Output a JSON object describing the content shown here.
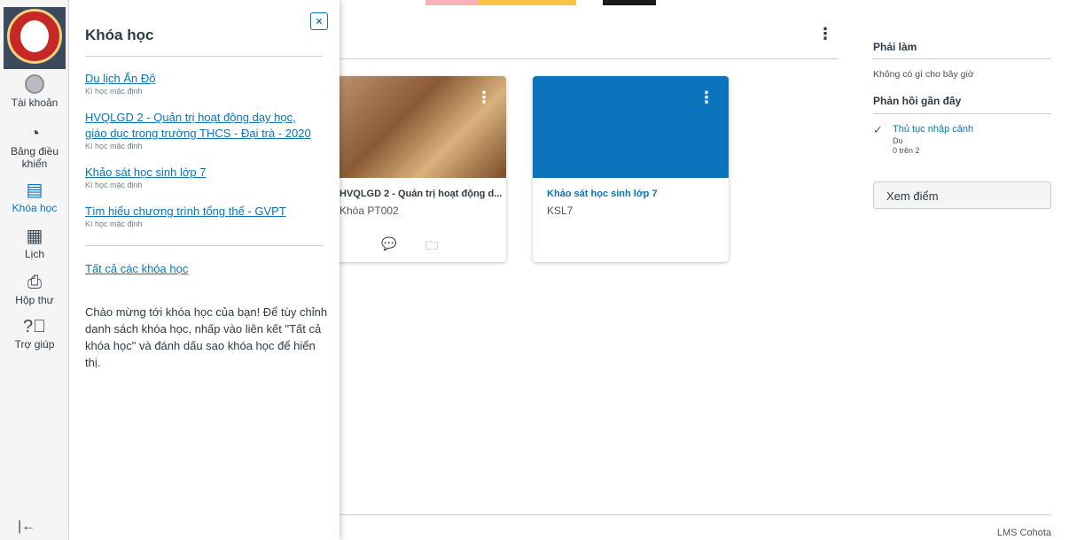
{
  "nav": {
    "account_label": "Tài khoản",
    "dashboard_label_1": "Bảng điều",
    "dashboard_label_2": "khiển",
    "courses_label": "Khóa học",
    "calendar_label": "Lịch",
    "inbox_label": "Hộp thư",
    "help_label": "Trợ giúp",
    "collapse_icon_glyph": "|←"
  },
  "tray": {
    "title": "Khóa học",
    "close_glyph": "×",
    "courses": [
      {
        "name_lines": [
          "Du lịch Ấn Độ"
        ],
        "term": "Kì học mặc định"
      },
      {
        "name_lines": [
          "HVQLGD 2 - Quản trị hoạt động dạy học,",
          "giáo dục trong trường THCS - Đại trà - 2020"
        ],
        "term": "Kì học mặc định"
      },
      {
        "name_lines": [
          "Khảo sát học sinh lớp 7"
        ],
        "term": "Kì học mặc định"
      },
      {
        "name_lines": [
          "Tìm hiểu chương trình tổng thể - GVPT"
        ],
        "term": "Kì học mặc định"
      }
    ],
    "all_courses_link": "Tất cả các khóa học",
    "welcome_text": "Chào mừng tới khóa học của bạn! Để tùy chỉnh danh sách khóa học, nhấp vào liên kết \"Tất cả khóa học\" và đánh dấu sao khóa học để hiển thị."
  },
  "main": {
    "cards": [
      {
        "title": "HVQLGD 2 - Quản trị hoạt động d...",
        "short": "Khóa PT002",
        "color": "#a46a3c"
      },
      {
        "title": "Khảo sát học sinh lớp 7",
        "short": "KSL7",
        "color": "#0b74bd"
      }
    ],
    "footer": "LMS Cohota"
  },
  "sidebar": {
    "todo_title": "Phải làm",
    "todo_empty": "Không có gì cho bây giờ",
    "feedback_title": "Phản hồi gần đây",
    "feedback_item": {
      "title": "Thủ tục nhập cảnh",
      "course": "Du",
      "score": "0 trên 2"
    },
    "grades_button": "Xem điểm"
  },
  "colors": {
    "accent": "#0b74bd",
    "nav_bg": "#f5f5f5",
    "check": "#2e7d32"
  }
}
